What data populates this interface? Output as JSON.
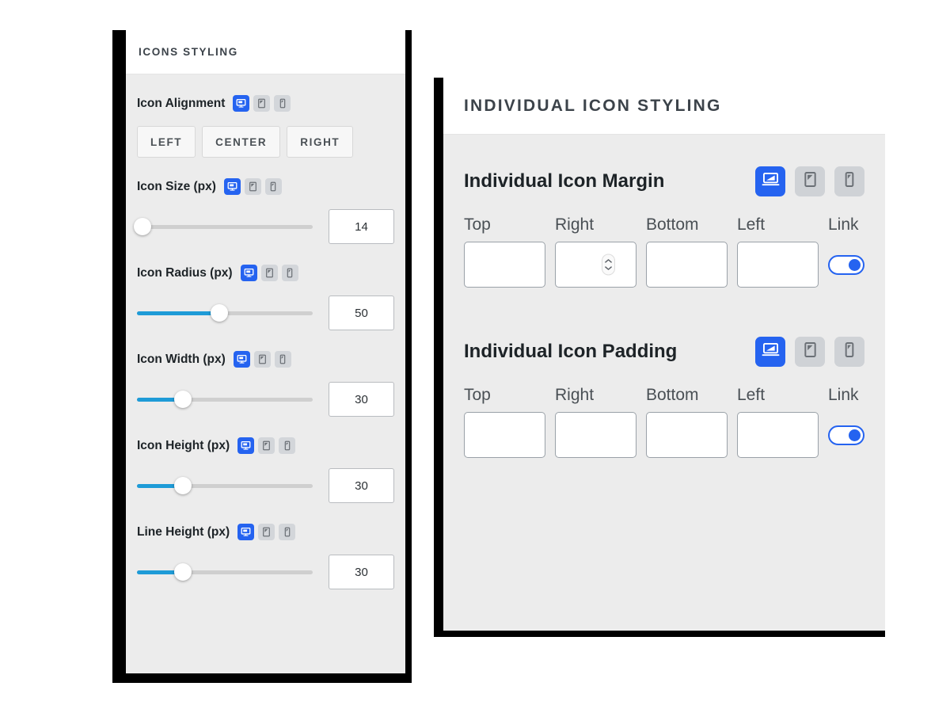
{
  "left_panel": {
    "header": {
      "title": "ICONS STYLING"
    },
    "icon_alignment": {
      "label": "Icon Alignment",
      "devices": [
        {
          "icon": "desktop-icon",
          "active": true
        },
        {
          "icon": "tablet-icon",
          "active": false
        },
        {
          "icon": "mobile-icon",
          "active": false
        }
      ],
      "options": [
        "LEFT",
        "CENTER",
        "RIGHT"
      ]
    },
    "controls": [
      {
        "label": "Icon Size (px)",
        "value": "14",
        "fill_percent": 3,
        "devices": [
          {
            "icon": "desktop-icon",
            "active": true
          },
          {
            "icon": "tablet-icon",
            "active": false
          },
          {
            "icon": "mobile-icon",
            "active": false
          }
        ]
      },
      {
        "label": "Icon Radius (px)",
        "value": "50",
        "fill_percent": 47,
        "devices": [
          {
            "icon": "desktop-icon",
            "active": true
          },
          {
            "icon": "tablet-icon",
            "active": false
          },
          {
            "icon": "mobile-icon",
            "active": false
          }
        ]
      },
      {
        "label": "Icon Width (px)",
        "value": "30",
        "fill_percent": 26,
        "devices": [
          {
            "icon": "desktop-icon",
            "active": true
          },
          {
            "icon": "tablet-icon",
            "active": false
          },
          {
            "icon": "mobile-icon",
            "active": false
          }
        ]
      },
      {
        "label": "Icon Height (px)",
        "value": "30",
        "fill_percent": 26,
        "devices": [
          {
            "icon": "desktop-icon",
            "active": true
          },
          {
            "icon": "tablet-icon",
            "active": false
          },
          {
            "icon": "mobile-icon",
            "active": false
          }
        ]
      },
      {
        "label": "Line Height (px)",
        "value": "30",
        "fill_percent": 26,
        "devices": [
          {
            "icon": "desktop-icon",
            "active": true
          },
          {
            "icon": "tablet-icon",
            "active": false
          },
          {
            "icon": "mobile-icon",
            "active": false
          }
        ]
      }
    ]
  },
  "right_panel": {
    "header": {
      "title": "INDIVIDUAL ICON STYLING"
    },
    "sections": [
      {
        "label": "Individual Icon Margin",
        "devices": [
          {
            "icon": "laptop-icon",
            "active": true
          },
          {
            "icon": "tablet-icon",
            "active": false
          },
          {
            "icon": "mobile-icon",
            "active": false
          }
        ],
        "fields": [
          {
            "label": "Top",
            "value": "",
            "spinner": false
          },
          {
            "label": "Right",
            "value": "",
            "spinner": true
          },
          {
            "label": "Bottom",
            "value": "",
            "spinner": false
          },
          {
            "label": "Left",
            "value": "",
            "spinner": false
          }
        ],
        "link": {
          "label": "Link",
          "on": true
        }
      },
      {
        "label": "Individual Icon Padding",
        "devices": [
          {
            "icon": "laptop-icon",
            "active": true
          },
          {
            "icon": "tablet-icon",
            "active": false
          },
          {
            "icon": "mobile-icon",
            "active": false
          }
        ],
        "fields": [
          {
            "label": "Top",
            "value": "",
            "spinner": false
          },
          {
            "label": "Right",
            "value": "",
            "spinner": false
          },
          {
            "label": "Bottom",
            "value": "",
            "spinner": false
          },
          {
            "label": "Left",
            "value": "",
            "spinner": false
          }
        ],
        "link": {
          "label": "Link",
          "on": true
        }
      }
    ]
  },
  "colors": {
    "accent_blue": "#2563f0",
    "slider_blue": "#1e9bd7",
    "panel_bg": "#ececec",
    "header_bg": "#ffffff",
    "frame": "#000000"
  }
}
